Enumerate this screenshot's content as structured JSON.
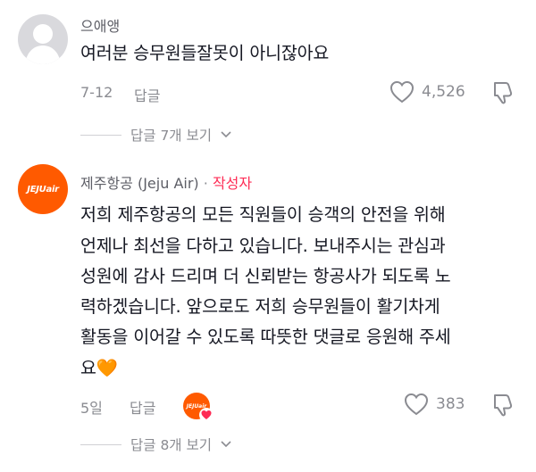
{
  "comments": [
    {
      "username": "으애앵",
      "text": "여러분 승무원들잘못이 아니잖아요",
      "date": "7-12",
      "reply_label": "답글",
      "likes": "4,526",
      "view_replies": "답글 7개 보기"
    },
    {
      "username": "제주항공 (Jeju Air)",
      "separator": "·",
      "author_tag": "작성자",
      "avatar_text": "JEJUair",
      "lines": [
        "저희 제주항공의 모든 직원들이 승객의 안전을 위해",
        "언제나 최선을 다하고 있습니다. 보내주시는 관심과",
        "성원에 감사 드리며 더 신뢰받는 항공사가 되도록 노",
        "력하겠습니다. 앞으로도 저희 승무원들이 활기차게",
        "활동을 이어갈 수 있도록 따뜻한 댓글로 응원해 주세",
        "요"
      ],
      "emoji": "🧡",
      "date": "5일",
      "reply_label": "답글",
      "likes": "383",
      "view_replies": "답글 8개 보기"
    }
  ],
  "colors": {
    "author_accent": "#fe2c55",
    "jeju_orange": "#ff5a00",
    "muted": "#8a8b91"
  }
}
